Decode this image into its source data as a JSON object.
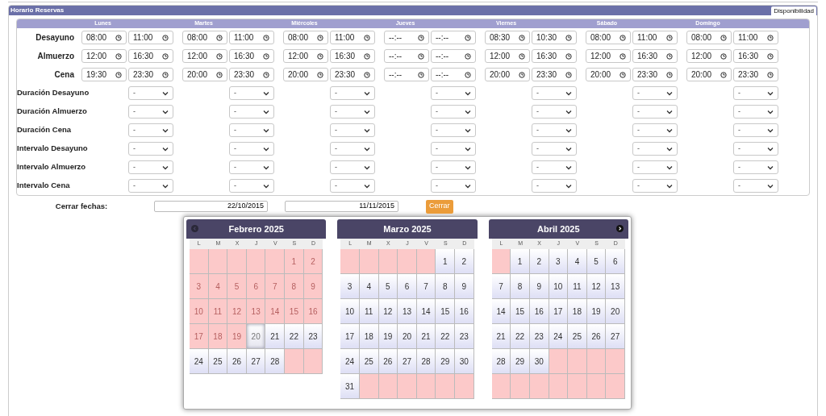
{
  "section": {
    "title": "Horario Reservas",
    "tab": "Disponibilidad"
  },
  "days": [
    "Lunes",
    "Martes",
    "Miércoles",
    "Jueves",
    "Viernes",
    "Sábado",
    "Domingo"
  ],
  "meals": [
    {
      "label": "Desayuno",
      "times": [
        [
          "08:00",
          "11:00"
        ],
        [
          "08:00",
          "11:00"
        ],
        [
          "08:00",
          "11:00"
        ],
        [
          "--:--",
          "--:--"
        ],
        [
          "08:30",
          "10:30"
        ],
        [
          "08:00",
          "11:00"
        ],
        [
          "08:00",
          "11:00"
        ]
      ]
    },
    {
      "label": "Almuerzo",
      "times": [
        [
          "12:00",
          "16:30"
        ],
        [
          "12:00",
          "16:30"
        ],
        [
          "12:00",
          "16:30"
        ],
        [
          "--:--",
          "--:--"
        ],
        [
          "12:00",
          "16:30"
        ],
        [
          "12:00",
          "16:30"
        ],
        [
          "12:00",
          "16:30"
        ]
      ]
    },
    {
      "label": "Cena",
      "times": [
        [
          "19:30",
          "23:30"
        ],
        [
          "20:00",
          "23:30"
        ],
        [
          "20:00",
          "23:30"
        ],
        [
          "--:--",
          "--:--"
        ],
        [
          "20:00",
          "23:30"
        ],
        [
          "20:00",
          "23:30"
        ],
        [
          "20:00",
          "23:30"
        ]
      ]
    }
  ],
  "settings": [
    {
      "label": "Duración Desayuno",
      "values": [
        "-",
        "-",
        "-",
        "-",
        "-",
        "-",
        "-"
      ]
    },
    {
      "label": "Duración Almuerzo",
      "values": [
        "-",
        "-",
        "-",
        "-",
        "-",
        "-",
        "-"
      ]
    },
    {
      "label": "Duración Cena",
      "values": [
        "-",
        "-",
        "-",
        "-",
        "-",
        "-",
        "-"
      ]
    },
    {
      "label": "Intervalo Desayuno",
      "values": [
        "-",
        "-",
        "-",
        "-",
        "-",
        "-",
        "-"
      ]
    },
    {
      "label": "Intervalo Almuerzo",
      "values": [
        "-",
        "-",
        "-",
        "-",
        "-",
        "-",
        "-"
      ]
    },
    {
      "label": "Intervalo Cena",
      "values": [
        "-",
        "-",
        "-",
        "-",
        "-",
        "-",
        "-"
      ]
    }
  ],
  "close_dates": {
    "label": "Cerrar fechas:",
    "from": "22/10/2015",
    "to": "11/11/2015",
    "button": "Cerrar"
  },
  "calendar": {
    "months": [
      {
        "title": "Febrero 2025",
        "has_prev": true,
        "has_next": false,
        "weekdays": [
          "L",
          "M",
          "X",
          "J",
          "V",
          "S",
          "D"
        ],
        "weeks": [
          [
            {
              "closed": true,
              "today": false
            },
            {
              "closed": true,
              "today": false
            },
            {
              "closed": true,
              "today": false
            },
            {
              "closed": true,
              "today": false
            },
            {
              "closed": true,
              "today": false
            },
            {
              "day": "1",
              "closed": true,
              "today": false
            },
            {
              "day": "2",
              "closed": true,
              "today": false
            }
          ],
          [
            {
              "day": "3",
              "closed": true,
              "today": false
            },
            {
              "day": "4",
              "closed": true,
              "today": false
            },
            {
              "day": "5",
              "closed": true,
              "today": false
            },
            {
              "day": "6",
              "closed": true,
              "today": false
            },
            {
              "day": "7",
              "closed": true,
              "today": false
            },
            {
              "day": "8",
              "closed": true,
              "today": false
            },
            {
              "day": "9",
              "closed": true,
              "today": false
            }
          ],
          [
            {
              "day": "10",
              "closed": true,
              "today": false
            },
            {
              "day": "11",
              "closed": true,
              "today": false
            },
            {
              "day": "12",
              "closed": true,
              "today": false
            },
            {
              "day": "13",
              "closed": true,
              "today": false
            },
            {
              "day": "14",
              "closed": true,
              "today": false
            },
            {
              "day": "15",
              "closed": true,
              "today": false
            },
            {
              "day": "16",
              "closed": true,
              "today": false
            }
          ],
          [
            {
              "day": "17",
              "closed": true,
              "today": false
            },
            {
              "day": "18",
              "closed": true,
              "today": false
            },
            {
              "day": "19",
              "closed": true,
              "today": false
            },
            {
              "day": "20",
              "closed": false,
              "today": true
            },
            {
              "day": "21",
              "closed": false,
              "today": false
            },
            {
              "day": "22",
              "closed": false,
              "today": false
            },
            {
              "day": "23",
              "closed": false,
              "today": false
            }
          ],
          [
            {
              "day": "24",
              "closed": false,
              "today": false
            },
            {
              "day": "25",
              "closed": false,
              "today": false
            },
            {
              "day": "26",
              "closed": false,
              "today": false
            },
            {
              "day": "27",
              "closed": false,
              "today": false
            },
            {
              "day": "28",
              "closed": false,
              "today": false
            },
            {
              "closed": true,
              "today": false
            },
            {
              "closed": true,
              "today": false
            }
          ]
        ]
      },
      {
        "title": "Marzo 2025",
        "has_prev": false,
        "has_next": false,
        "weekdays": [
          "L",
          "M",
          "X",
          "J",
          "V",
          "S",
          "D"
        ],
        "weeks": [
          [
            {
              "closed": true,
              "today": false
            },
            {
              "closed": true,
              "today": false
            },
            {
              "closed": true,
              "today": false
            },
            {
              "closed": true,
              "today": false
            },
            {
              "closed": true,
              "today": false
            },
            {
              "day": "1",
              "closed": false,
              "today": false
            },
            {
              "day": "2",
              "closed": false,
              "today": false
            }
          ],
          [
            {
              "day": "3",
              "closed": false,
              "today": false
            },
            {
              "day": "4",
              "closed": false,
              "today": false
            },
            {
              "day": "5",
              "closed": false,
              "today": false
            },
            {
              "day": "6",
              "closed": false,
              "today": false
            },
            {
              "day": "7",
              "closed": false,
              "today": false
            },
            {
              "day": "8",
              "closed": false,
              "today": false
            },
            {
              "day": "9",
              "closed": false,
              "today": false
            }
          ],
          [
            {
              "day": "10",
              "closed": false,
              "today": false
            },
            {
              "day": "11",
              "closed": false,
              "today": false
            },
            {
              "day": "12",
              "closed": false,
              "today": false
            },
            {
              "day": "13",
              "closed": false,
              "today": false
            },
            {
              "day": "14",
              "closed": false,
              "today": false
            },
            {
              "day": "15",
              "closed": false,
              "today": false
            },
            {
              "day": "16",
              "closed": false,
              "today": false
            }
          ],
          [
            {
              "day": "17",
              "closed": false,
              "today": false
            },
            {
              "day": "18",
              "closed": false,
              "today": false
            },
            {
              "day": "19",
              "closed": false,
              "today": false
            },
            {
              "day": "20",
              "closed": false,
              "today": false
            },
            {
              "day": "21",
              "closed": false,
              "today": false
            },
            {
              "day": "22",
              "closed": false,
              "today": false
            },
            {
              "day": "23",
              "closed": false,
              "today": false
            }
          ],
          [
            {
              "day": "24",
              "closed": false,
              "today": false
            },
            {
              "day": "25",
              "closed": false,
              "today": false
            },
            {
              "day": "26",
              "closed": false,
              "today": false
            },
            {
              "day": "27",
              "closed": false,
              "today": false
            },
            {
              "day": "28",
              "closed": false,
              "today": false
            },
            {
              "day": "29",
              "closed": false,
              "today": false
            },
            {
              "day": "30",
              "closed": false,
              "today": false
            }
          ],
          [
            {
              "day": "31",
              "closed": false,
              "today": false
            },
            {
              "closed": true,
              "today": false
            },
            {
              "closed": true,
              "today": false
            },
            {
              "closed": true,
              "today": false
            },
            {
              "closed": true,
              "today": false
            },
            {
              "closed": true,
              "today": false
            },
            {
              "closed": true,
              "today": false
            }
          ]
        ]
      },
      {
        "title": "Abril 2025",
        "has_prev": false,
        "has_next": true,
        "weekdays": [
          "L",
          "M",
          "X",
          "J",
          "V",
          "S",
          "D"
        ],
        "weeks": [
          [
            {
              "closed": true,
              "today": false
            },
            {
              "day": "1",
              "closed": false,
              "today": false
            },
            {
              "day": "2",
              "closed": false,
              "today": false
            },
            {
              "day": "3",
              "closed": false,
              "today": false
            },
            {
              "day": "4",
              "closed": false,
              "today": false
            },
            {
              "day": "5",
              "closed": false,
              "today": false
            },
            {
              "day": "6",
              "closed": false,
              "today": false
            }
          ],
          [
            {
              "day": "7",
              "closed": false,
              "today": false
            },
            {
              "day": "8",
              "closed": false,
              "today": false
            },
            {
              "day": "9",
              "closed": false,
              "today": false
            },
            {
              "day": "10",
              "closed": false,
              "today": false
            },
            {
              "day": "11",
              "closed": false,
              "today": false
            },
            {
              "day": "12",
              "closed": false,
              "today": false
            },
            {
              "day": "13",
              "closed": false,
              "today": false
            }
          ],
          [
            {
              "day": "14",
              "closed": false,
              "today": false
            },
            {
              "day": "15",
              "closed": false,
              "today": false
            },
            {
              "day": "16",
              "closed": false,
              "today": false
            },
            {
              "day": "17",
              "closed": false,
              "today": false
            },
            {
              "day": "18",
              "closed": false,
              "today": false
            },
            {
              "day": "19",
              "closed": false,
              "today": false
            },
            {
              "day": "20",
              "closed": false,
              "today": false
            }
          ],
          [
            {
              "day": "21",
              "closed": false,
              "today": false
            },
            {
              "day": "22",
              "closed": false,
              "today": false
            },
            {
              "day": "23",
              "closed": false,
              "today": false
            },
            {
              "day": "24",
              "closed": false,
              "today": false
            },
            {
              "day": "25",
              "closed": false,
              "today": false
            },
            {
              "day": "26",
              "closed": false,
              "today": false
            },
            {
              "day": "27",
              "closed": false,
              "today": false
            }
          ],
          [
            {
              "day": "28",
              "closed": false,
              "today": false
            },
            {
              "day": "29",
              "closed": false,
              "today": false
            },
            {
              "day": "30",
              "closed": false,
              "today": false
            },
            {
              "closed": true,
              "today": false
            },
            {
              "closed": true,
              "today": false
            },
            {
              "closed": true,
              "today": false
            },
            {
              "closed": true,
              "today": false
            }
          ],
          [
            {
              "closed": true,
              "today": false
            },
            {
              "closed": true,
              "today": false
            },
            {
              "closed": true,
              "today": false
            },
            {
              "closed": true,
              "today": false
            },
            {
              "closed": true,
              "today": false
            },
            {
              "closed": true,
              "today": false
            },
            {
              "closed": true,
              "today": false
            }
          ]
        ]
      }
    ]
  }
}
